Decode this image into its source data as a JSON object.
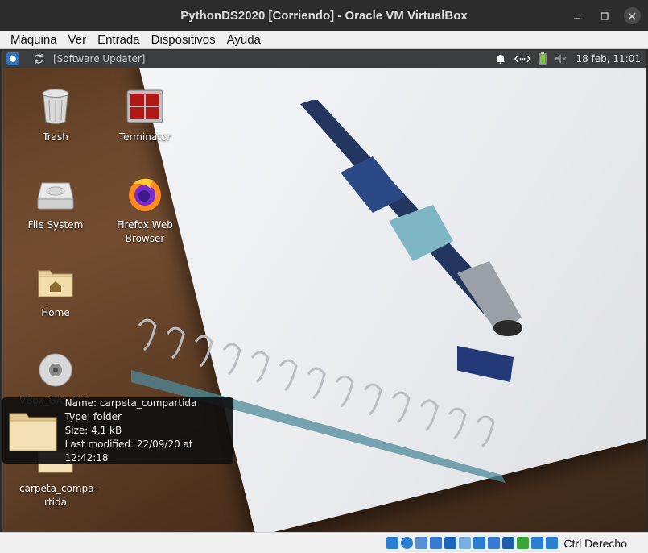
{
  "window": {
    "title": "PythonDS2020 [Corriendo] - Oracle VM VirtualBox",
    "controls": [
      "minimize-icon",
      "maximize-icon",
      "close-icon"
    ]
  },
  "menubar": {
    "items": [
      "Máquina",
      "Ver",
      "Entrada",
      "Dispositivos",
      "Ayuda"
    ]
  },
  "panel": {
    "task_label": "[Software Updater]",
    "clock": "18 feb, 11:01",
    "tray_icons": [
      "bell-icon",
      "network-icon",
      "battery-icon",
      "volume-muted-icon"
    ]
  },
  "desktop": {
    "icons": [
      {
        "name": "trash",
        "label": "Trash",
        "icon": "trash-icon"
      },
      {
        "name": "terminator",
        "label": "Terminator",
        "icon": "terminal-icon"
      },
      {
        "name": "file-system",
        "label": "File System",
        "icon": "drive-icon"
      },
      {
        "name": "firefox",
        "label": "Firefox Web Browser",
        "icon": "firefox-icon"
      },
      {
        "name": "home",
        "label": "Home",
        "icon": "home-folder-icon"
      },
      {
        "name": "vbox-gas",
        "label": "VBox_GAs_6.1.-",
        "icon": "cd-icon"
      },
      {
        "name": "carpeta",
        "label": "carpeta_compa-tida",
        "label_lines": [
          "carpeta_compa-",
          "rtida"
        ],
        "icon": "folder-icon"
      }
    ],
    "tooltip": {
      "name": "Name: carpeta_compartida",
      "type": "Type: folder",
      "size": "Size: 4,1 kB",
      "modified": "Last modified: 22/09/20 at 12:42:18",
      "icon": "folder-icon"
    }
  },
  "statusbar": {
    "host_key": "Ctrl Derecho",
    "icons": [
      "hdd-icon",
      "optical-icon",
      "audio-icon",
      "network-icon",
      "usb-icon",
      "shared-folder-icon",
      "display-icon",
      "video-capture-icon",
      "vrde-icon",
      "cpu-icon",
      "mouse-icon",
      "arrow-down-icon"
    ],
    "colors": {
      "accent": "#2a7fd0",
      "green": "#3aa63a"
    }
  }
}
